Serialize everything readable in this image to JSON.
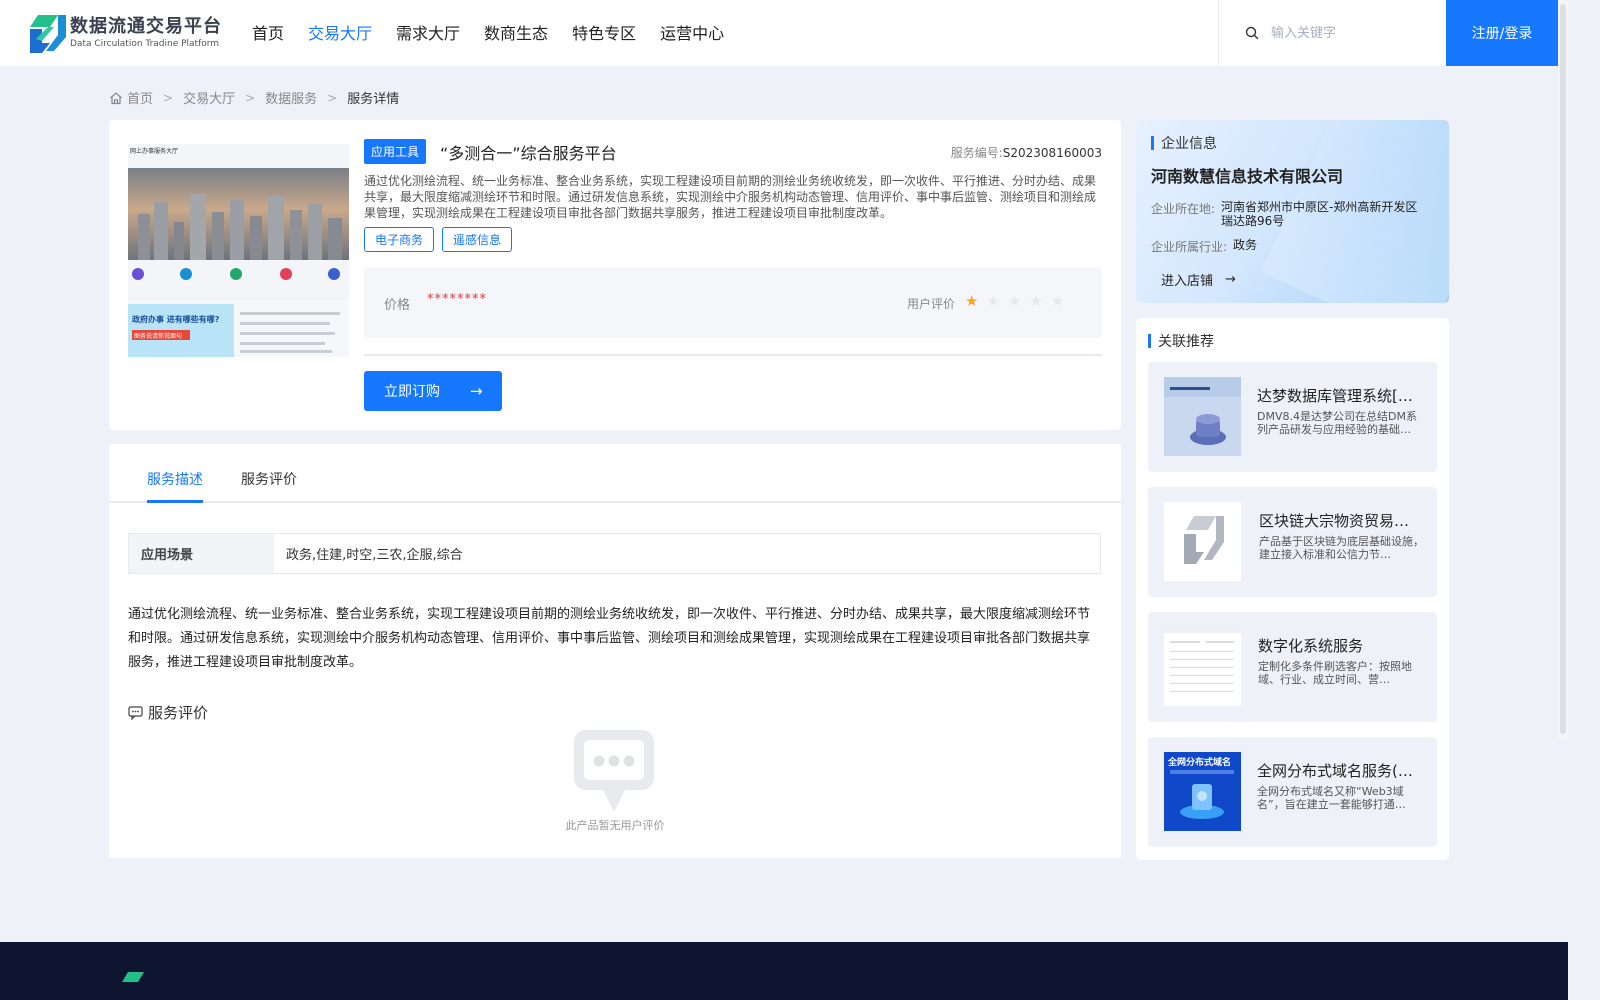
{
  "header": {
    "logo_cn": "数据流通交易平台",
    "logo_en": "Data Circulation Tradine Platform",
    "nav": [
      "首页",
      "交易大厅",
      "需求大厅",
      "数商生态",
      "特色专区",
      "运营中心"
    ],
    "nav_active_index": 1,
    "search_placeholder": "输入关键字",
    "login_label": "注册/登录"
  },
  "breadcrumb": {
    "home": "首页",
    "items": [
      "交易大厅",
      "数据服务"
    ],
    "current": "服务详情",
    "separator": ">"
  },
  "product": {
    "type_tag": "应用工具",
    "title": "“多测合一”综合服务平台",
    "service_no_label": "服务编号:",
    "service_no": "S202308160003",
    "description": "通过优化测绘流程、统一业务标准、整合业务系统，实现工程建设项目前期的测绘业务统收统发，即一次收件、平行推进、分时办结、成果共享，最大限度缩减测绘环节和时限。通过研发信息系统，实现测绘中介服务机构动态管理、信用评价、事中事后监管、测绘项目和测绘成果管理，实现测绘成果在工程建设项目审批各部门数据共享服务，推进工程建设项目审批制度改革。",
    "tags": [
      "电子商务",
      "遥感信息"
    ],
    "price_label": "价格",
    "price_value": "********",
    "rating_label": "用户评价",
    "rating": 1,
    "rating_max": 5,
    "subscribe_label": "立即订购",
    "subscribe_arrow": "→"
  },
  "detail": {
    "tabs": [
      "服务描述",
      "服务评价"
    ],
    "active_tab": 0,
    "scene_label": "应用场景",
    "scene_value": "政务,住建,时空,三农,企服,综合",
    "long_description": "通过优化测绘流程、统一业务标准、整合业务系统，实现工程建设项目前期的测绘业务统收统发，即一次收件、平行推进、分时办结、成果共享，最大限度缩减测绘环节和时限。通过研发信息系统，实现测绘中介服务机构动态管理、信用评价、事中事后监管、测绘项目和测绘成果管理，实现测绘成果在工程建设项目审批各部门数据共享服务，推进工程建设项目审批制度改革。",
    "review_title": "服务评价",
    "empty_text": "此产品暂无用户评价"
  },
  "company": {
    "section_title": "企业信息",
    "name": "河南数慧信息技术有限公司",
    "location_label": "企业所在地:",
    "location": "河南省郑州市中原区-郑州高新开发区瑞达路96号",
    "industry_label": "企业所属行业:",
    "industry": "政务",
    "enter_label": "进入店铺",
    "enter_arrow": "→"
  },
  "recommend": {
    "section_title": "关联推荐",
    "items": [
      {
        "title": "达梦数据库管理系统[…",
        "desc": "DMV8.4是达梦公司在总结DM系列产品研发与应用经验的基础…",
        "thumb": "database-product-image"
      },
      {
        "title": "区块链大宗物资贸易…",
        "desc": "产品基于区块链为底层基础设施，建立接入标准和公信力节…",
        "thumb": "platform-logo-image"
      },
      {
        "title": "数字化系统服务",
        "desc": "定制化多条件刷选客户：按照地域、行业、成立时间、营…",
        "thumb": "system-screenshot-image"
      },
      {
        "title": "全网分布式域名服务(…",
        "desc": "全网分布式域名又称“Web3域名”，旨在建立一套能够打通…",
        "thumb": "domain-service-image"
      }
    ],
    "thumb4_caption": "全网分布式域名"
  },
  "image_overlay": {
    "top_caption": "网上办事服务大厅",
    "banner_text": "政府办事 进有哪些有哪?",
    "banner_sub": "图务说请你说面句"
  },
  "colors": {
    "primary": "#1677ff",
    "price": "#e8383d",
    "star_on": "#f5a623",
    "footer": "#0d1530",
    "page_bg": "#eef1f8"
  }
}
